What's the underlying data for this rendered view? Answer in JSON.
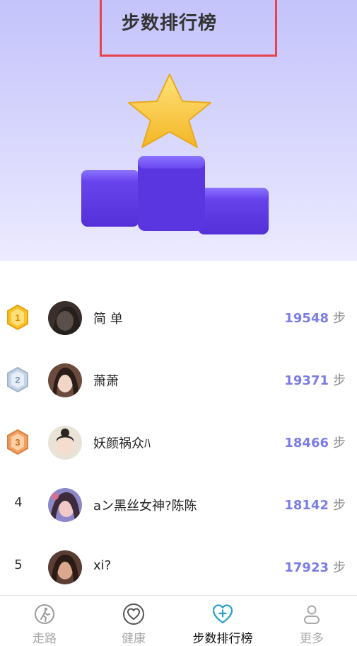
{
  "header": {
    "title": "步数排行榜"
  },
  "ranking": [
    {
      "rank": "1",
      "name": "简 单",
      "steps": "19548",
      "unit": "步"
    },
    {
      "rank": "2",
      "name": "萧萧",
      "steps": "19371",
      "unit": "步"
    },
    {
      "rank": "3",
      "name": "妖颜祸众ﾊ",
      "steps": "18466",
      "unit": "步"
    },
    {
      "rank": "4",
      "name": "aン黑丝女神?陈陈",
      "steps": "18142",
      "unit": "步"
    },
    {
      "rank": "5",
      "name": "xi?",
      "steps": "17923",
      "unit": "步"
    }
  ],
  "tabbar": {
    "items": [
      {
        "label": "走路",
        "icon": "walk-icon"
      },
      {
        "label": "健康",
        "icon": "heart-icon"
      },
      {
        "label": "步数排行榜",
        "icon": "heart-plus-icon"
      },
      {
        "label": "更多",
        "icon": "user-icon"
      }
    ],
    "active": "步数排行榜"
  },
  "colors": {
    "accent": "#7b7ce6",
    "tab_active": "#2aa0c8",
    "highlight_border": "#e8434a",
    "podium": "#6f4df2",
    "star": "#f7c642"
  }
}
